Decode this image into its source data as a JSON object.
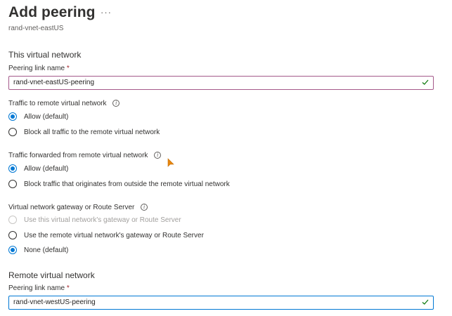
{
  "header": {
    "title": "Add peering",
    "more": "···",
    "subtitle": "rand-vnet-eastUS"
  },
  "this_network": {
    "heading": "This virtual network",
    "peering_label": "Peering link name",
    "required": "*",
    "peering_value": "rand-vnet-eastUS-peering"
  },
  "traffic_to_remote": {
    "label": "Traffic to remote virtual network",
    "options": [
      "Allow (default)",
      "Block all traffic to the remote virtual network"
    ],
    "selected": 0
  },
  "traffic_forwarded": {
    "label": "Traffic forwarded from remote virtual network",
    "options": [
      "Allow (default)",
      "Block traffic that originates from outside the remote virtual network"
    ],
    "selected": 0
  },
  "gateway": {
    "label": "Virtual network gateway or Route Server",
    "options": [
      "Use this virtual network's gateway or Route Server",
      "Use the remote virtual network's gateway or Route Server",
      "None (default)"
    ],
    "disabled": [
      0
    ],
    "selected": 2
  },
  "remote_network": {
    "heading": "Remote virtual network",
    "peering_label": "Peering link name",
    "required": "*",
    "peering_value": "rand-vnet-westUS-peering"
  },
  "icons": {
    "info": "info-icon",
    "check": "checkmark-icon",
    "cursor": "mouse-cursor-icon"
  },
  "colors": {
    "accent": "#0078d4",
    "valid_check": "#107c10",
    "required": "#a4262c",
    "cursor": "#e8860c"
  }
}
